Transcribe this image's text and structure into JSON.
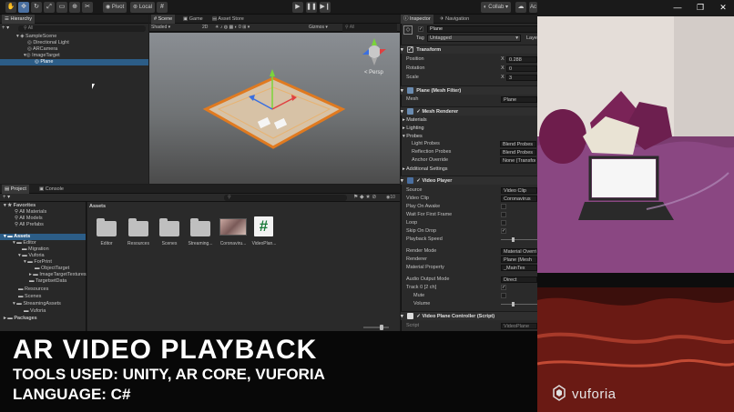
{
  "toolbar": {
    "pivot": "Pivot",
    "local": "Local",
    "collab": "Collab",
    "account": "Ac"
  },
  "hierarchy": {
    "tab": "Hierarchy",
    "search_placeholder": "All",
    "items": [
      "SampleScene",
      "Directional Light",
      "ARCamera",
      "ImageTarget",
      "Plane"
    ]
  },
  "scene": {
    "tabs": [
      "Scene",
      "Game",
      "Asset Store"
    ],
    "shading": "Shaded",
    "mode_2d": "2D",
    "gizmos": "Gizmos",
    "search_placeholder": "All",
    "persp": "< Persp"
  },
  "project": {
    "tabs": [
      "Project",
      "Console"
    ],
    "count": "10",
    "favorites": [
      "Favorites",
      "All Materials",
      "All Models",
      "All Prefabs"
    ],
    "assets_tree": [
      "Assets",
      "Editor",
      "Migration",
      "Vuforia",
      "ForPrint",
      "ObjectTarget",
      "ImageTargetTextures",
      "TargetsetData",
      "Resources",
      "Scenes",
      "StreamingAssets",
      "Vuforia",
      "Packages"
    ],
    "breadcrumb": "Assets",
    "asset_items": [
      "Editor",
      "Resources",
      "Scenes",
      "Streaming...",
      "Coronaviru...",
      "VideoPlan..."
    ],
    "script_symbol": "#"
  },
  "inspector": {
    "tabs": [
      "Inspector",
      "Navigation"
    ],
    "object_name": "Plane",
    "tag_label": "Tag",
    "tag_value": "Untagged",
    "layer_label": "Laye",
    "transform": {
      "title": "Transform",
      "rows": [
        {
          "label": "Position",
          "axis": "X",
          "value": "0.288"
        },
        {
          "label": "Rotation",
          "axis": "X",
          "value": "0"
        },
        {
          "label": "Scale",
          "axis": "X",
          "value": "3"
        }
      ]
    },
    "mesh_filter": {
      "title": "Plane (Mesh Filter)",
      "label": "Mesh",
      "value": "Plane"
    },
    "mesh_renderer": {
      "title": "Mesh Renderer"
    },
    "sections": [
      "Materials",
      "Lighting",
      "Probes"
    ],
    "probes": [
      {
        "label": "Light Probes",
        "value": "Blend Probes"
      },
      {
        "label": "Reflection Probes",
        "value": "Blend Probes"
      },
      {
        "label": "Anchor Override",
        "value": "None (Transform"
      }
    ],
    "additional": "Additional Settings",
    "video_player": {
      "title": "Video Player",
      "rows": [
        {
          "label": "Source",
          "value": "Video Clip",
          "kind": "field"
        },
        {
          "label": "Video Clip",
          "value": "Coronavirus",
          "kind": "field"
        },
        {
          "label": "Play On Awake",
          "value": "",
          "kind": "check"
        },
        {
          "label": "Wait For First Frame",
          "value": "",
          "kind": "check"
        },
        {
          "label": "Loop",
          "value": "",
          "kind": "check"
        },
        {
          "label": "Skip On Drop",
          "value": "✓",
          "kind": "check"
        },
        {
          "label": "Playback Speed",
          "value": "",
          "kind": "slider"
        },
        {
          "label": "Render Mode",
          "value": "Material Overri",
          "kind": "field"
        },
        {
          "label": "Renderer",
          "value": "Plane (Mesh",
          "kind": "field"
        },
        {
          "label": "Material Property",
          "value": "_MainTex",
          "kind": "field"
        },
        {
          "label": "Audio Output Mode",
          "value": "Direct",
          "kind": "field"
        },
        {
          "label": "Track 0 [2 ch]",
          "value": "✓",
          "kind": "check"
        },
        {
          "label": "Mute",
          "value": "",
          "kind": "check"
        },
        {
          "label": "Volume",
          "value": "",
          "kind": "slider"
        }
      ]
    },
    "controller": {
      "title": "Video Plane Controller (Script)",
      "script_label": "Script",
      "script_value": "VideoPlane"
    }
  },
  "overlay": {
    "title": "AR VIDEO PLAYBACK",
    "tools": "TOOLS USED: UNITY, AR CORE, VUFORIA",
    "language": "LANGUAGE: C#"
  },
  "camera": {
    "logo_text": "vuforia"
  },
  "window": {
    "min": "—",
    "max": "❐",
    "close": "✕"
  }
}
